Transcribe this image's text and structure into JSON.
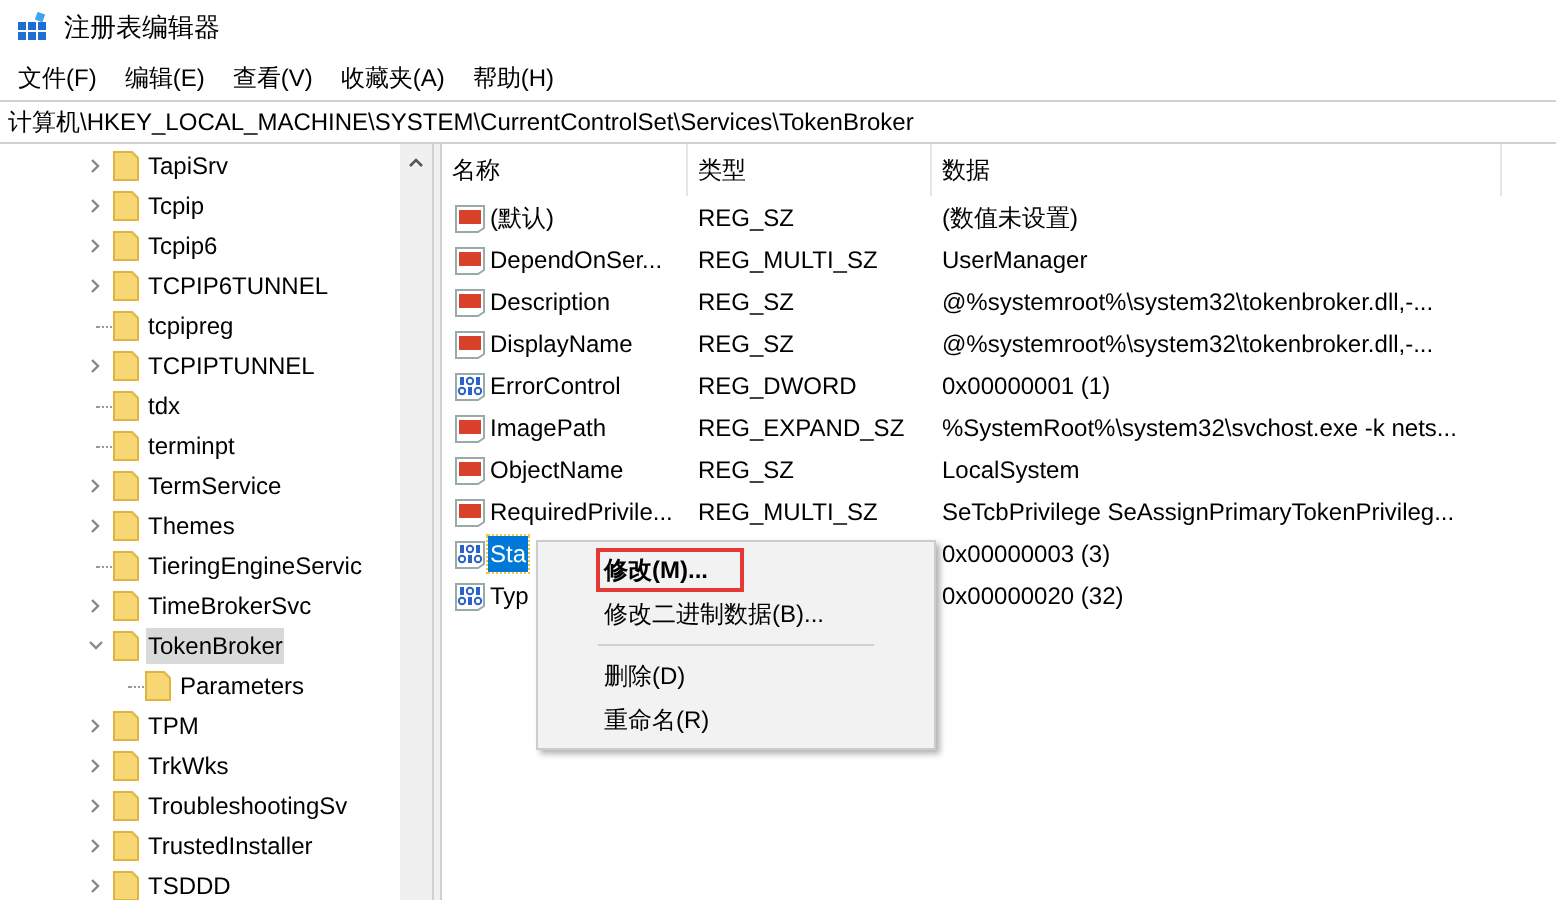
{
  "window": {
    "title": "注册表编辑器"
  },
  "menu": [
    "文件(F)",
    "编辑(E)",
    "查看(V)",
    "收藏夹(A)",
    "帮助(H)"
  ],
  "address": "计算机\\HKEY_LOCAL_MACHINE\\SYSTEM\\CurrentControlSet\\Services\\TokenBroker",
  "tree": [
    {
      "label": "TapiSrv",
      "kind": "collapsed",
      "selected": false
    },
    {
      "label": "Tcpip",
      "kind": "collapsed",
      "selected": false
    },
    {
      "label": "Tcpip6",
      "kind": "collapsed",
      "selected": false
    },
    {
      "label": "TCPIP6TUNNEL",
      "kind": "collapsed",
      "selected": false
    },
    {
      "label": "tcpipreg",
      "kind": "leaf",
      "selected": false
    },
    {
      "label": "TCPIPTUNNEL",
      "kind": "collapsed",
      "selected": false
    },
    {
      "label": "tdx",
      "kind": "leaf",
      "selected": false
    },
    {
      "label": "terminpt",
      "kind": "leaf",
      "selected": false
    },
    {
      "label": "TermService",
      "kind": "collapsed",
      "selected": false
    },
    {
      "label": "Themes",
      "kind": "collapsed",
      "selected": false
    },
    {
      "label": "TieringEngineServic",
      "kind": "leaf",
      "selected": false
    },
    {
      "label": "TimeBrokerSvc",
      "kind": "collapsed",
      "selected": false
    },
    {
      "label": "TokenBroker",
      "kind": "expanded",
      "selected": true,
      "children": [
        {
          "label": "Parameters",
          "kind": "leaf",
          "selected": false
        }
      ]
    },
    {
      "label": "TPM",
      "kind": "collapsed",
      "selected": false
    },
    {
      "label": "TrkWks",
      "kind": "collapsed",
      "selected": false
    },
    {
      "label": "TroubleshootingSv",
      "kind": "collapsed",
      "selected": false
    },
    {
      "label": "TrustedInstaller",
      "kind": "collapsed",
      "selected": false
    },
    {
      "label": "TSDDD",
      "kind": "collapsed",
      "selected": false
    }
  ],
  "table": {
    "columns": [
      "名称",
      "类型",
      "数据"
    ],
    "rows": [
      {
        "kind": "string",
        "name": "(默认)",
        "type": "REG_SZ",
        "data": "(数值未设置)",
        "selected": false
      },
      {
        "kind": "string",
        "name": "DependOnSer...",
        "type": "REG_MULTI_SZ",
        "data": "UserManager",
        "selected": false
      },
      {
        "kind": "string",
        "name": "Description",
        "type": "REG_SZ",
        "data": "@%systemroot%\\system32\\tokenbroker.dll,-...",
        "selected": false
      },
      {
        "kind": "string",
        "name": "DisplayName",
        "type": "REG_SZ",
        "data": "@%systemroot%\\system32\\tokenbroker.dll,-...",
        "selected": false
      },
      {
        "kind": "binary",
        "name": "ErrorControl",
        "type": "REG_DWORD",
        "data": "0x00000001 (1)",
        "selected": false
      },
      {
        "kind": "string",
        "name": "ImagePath",
        "type": "REG_EXPAND_SZ",
        "data": "%SystemRoot%\\system32\\svchost.exe -k nets...",
        "selected": false
      },
      {
        "kind": "string",
        "name": "ObjectName",
        "type": "REG_SZ",
        "data": "LocalSystem",
        "selected": false
      },
      {
        "kind": "string",
        "name": "RequiredPrivile...",
        "type": "REG_MULTI_SZ",
        "data": "SeTcbPrivilege SeAssignPrimaryTokenPrivileg...",
        "selected": false
      },
      {
        "kind": "binary",
        "name": "Sta",
        "data": "0x00000003 (3)",
        "selected": true
      },
      {
        "kind": "binary",
        "name": "Typ",
        "data": "0x00000020 (32)",
        "selected": false
      }
    ]
  },
  "context_menu": [
    {
      "kind": "item",
      "label": "修改(M)...",
      "bold": true,
      "highlighted": true
    },
    {
      "kind": "item",
      "label": "修改二进制数据(B)...",
      "bold": false,
      "highlighted": false
    },
    {
      "kind": "separator"
    },
    {
      "kind": "item",
      "label": "删除(D)",
      "bold": false,
      "highlighted": false
    },
    {
      "kind": "item",
      "label": "重命名(R)",
      "bold": false,
      "highlighted": false
    }
  ]
}
